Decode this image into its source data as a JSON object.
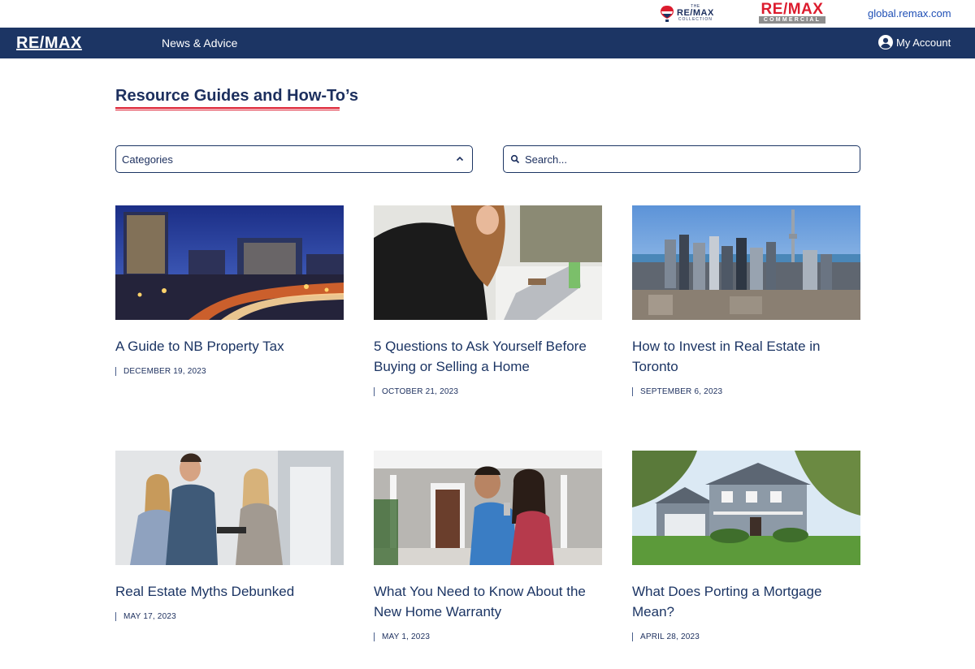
{
  "utility_bar": {
    "collection_logo": {
      "the": "THE",
      "name": "RE/MAX",
      "sub": "COLLECTION"
    },
    "commercial_logo": {
      "name": "RE/MAX",
      "sub": "COMMERCIAL"
    },
    "global_link": "global.remax.com"
  },
  "nav": {
    "logo": "RE/MAX",
    "news_link": "News & Advice",
    "account_label": "My Account"
  },
  "page": {
    "title": "Resource Guides and How-To’s"
  },
  "filters": {
    "categories_label": "Categories",
    "search_placeholder": "Search..."
  },
  "articles": [
    {
      "title": "A Guide to NB Property Tax",
      "date": "DECEMBER 19, 2023"
    },
    {
      "title": "5 Questions to Ask Yourself Before Buying or Selling a Home",
      "date": "OCTOBER 21, 2023"
    },
    {
      "title": "How to Invest in Real Estate in Toronto",
      "date": "SEPTEMBER 6, 2023"
    },
    {
      "title": "Real Estate Myths Debunked",
      "date": "MAY 17, 2023"
    },
    {
      "title": "What You Need to Know About the New Home Warranty",
      "date": "MAY 1, 2023"
    },
    {
      "title": "What Does Porting a Mortgage Mean?",
      "date": "APRIL 28, 2023"
    }
  ],
  "colors": {
    "brand_blue": "#1c3564",
    "brand_red": "#dc1c2e",
    "link_blue": "#1f4fb5"
  },
  "icons": [
    "remax-balloon-icon",
    "account-circle-icon",
    "chevron-up-icon",
    "search-icon"
  ]
}
